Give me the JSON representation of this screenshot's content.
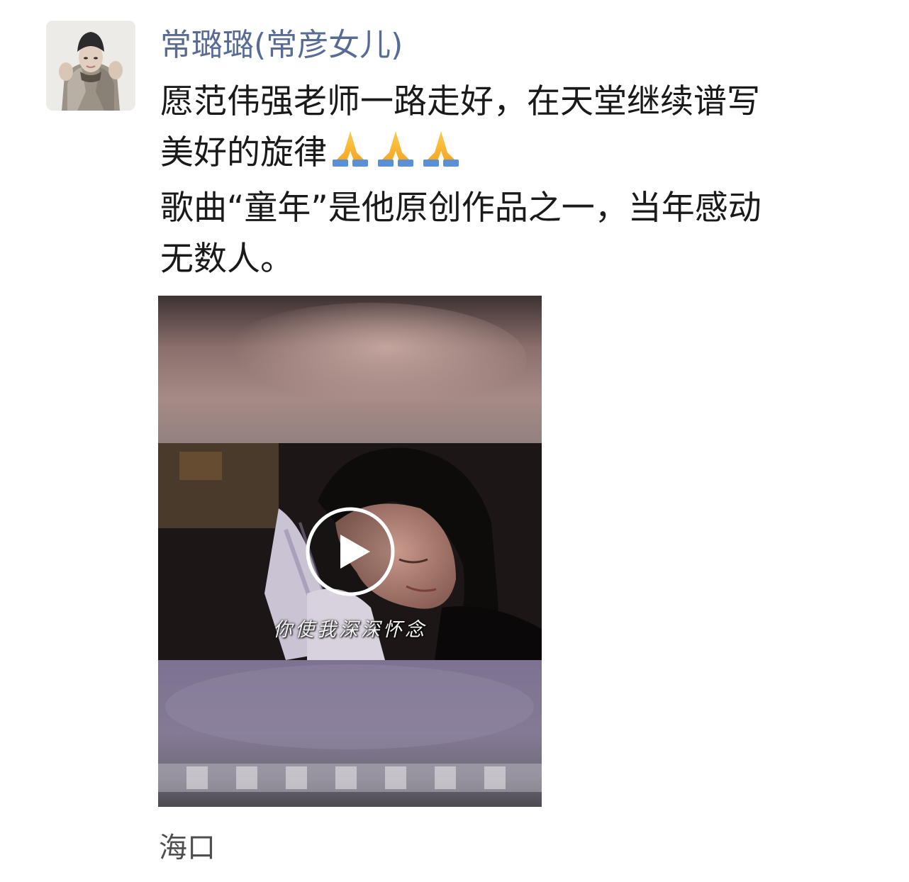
{
  "post": {
    "author": "常璐璐(常彦女儿)",
    "text_lines": [
      "愿范伟强老师一路走好，在天堂继续谱写",
      "美好的旋律",
      "歌曲“童年”是他原创作品之一，当年感动",
      "无数人。"
    ],
    "emoji": [
      "🙏",
      "🙏",
      "🙏"
    ],
    "emoji_icon": "folded-hands-icon",
    "video": {
      "subtitle": "你使我深深怀念",
      "play_icon": "play-icon"
    },
    "location": "海口"
  },
  "colors": {
    "author_name": "#586b94",
    "body_text": "#1a1a1a",
    "location_text": "#4f4f4f",
    "background": "#ffffff"
  }
}
